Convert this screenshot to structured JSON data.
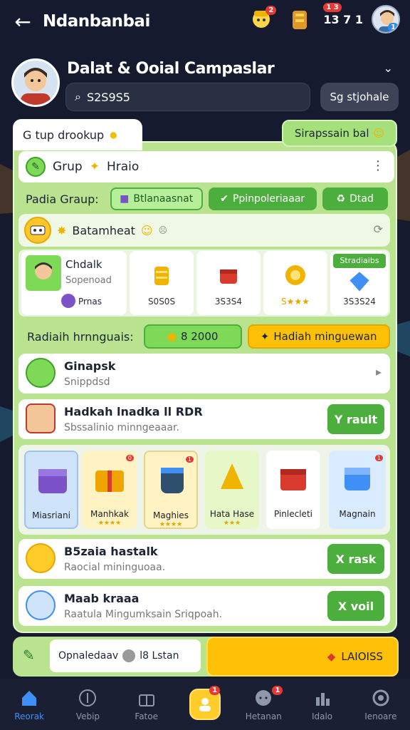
{
  "topbar": {
    "title": "Ndanbanbai",
    "back_label": "←",
    "coin_count": "13 7 1",
    "coin_badge": "1 3",
    "avatar_badge": "1",
    "mascot_badge": "2"
  },
  "header": {
    "title": "Dalat & Ooial Campaslar",
    "search_value": "S2S9S5",
    "search_button": "Sg stjohale"
  },
  "tabs": {
    "active_label": "G tup drookup",
    "right_label": "Sirapssain bal"
  },
  "group_row": {
    "label": "Grup",
    "label2": "Hraio"
  },
  "filters": {
    "label": "Padia Graup:",
    "pill1": "Btlanaasnat",
    "pill2": "Ppinpoleriaaar",
    "pill3": "Dtad"
  },
  "campaign_row": {
    "label": "Batamheat"
  },
  "products": [
    {
      "name": "Chdalk",
      "sub": "Sopenoad",
      "tag": "Prnas",
      "value": ""
    },
    {
      "name": "",
      "value": "S0S0S"
    },
    {
      "name": "",
      "value": "3S3S4"
    },
    {
      "name": "",
      "value": "S★★★"
    },
    {
      "name": "Stradiaibs",
      "value": "3S3S24"
    }
  ],
  "rewards": {
    "label": "Radiaih hrnnguais:",
    "amount": "8 2000",
    "button": "Hadiah minguewan"
  },
  "items": [
    {
      "title": "Ginapsk",
      "subtitle": "Snippdsd",
      "button": ""
    },
    {
      "title": "Hadkah lnadka ll RDR",
      "subtitle": "Sbssalinio minngeaaar.",
      "button": "Y rault"
    },
    {
      "title": "B5zaia hastalk",
      "subtitle": "Raocial mininguoaa.",
      "button": "X rask"
    },
    {
      "title": "Maab kraaa",
      "subtitle": "Raatula Mingumksain Sriqpoah.",
      "button": "X voil"
    }
  ],
  "gifts": [
    {
      "label": "Miasriani",
      "stars": "",
      "badge": ""
    },
    {
      "label": "Manhkak",
      "stars": "★★★★",
      "badge": "0"
    },
    {
      "label": "Maghies",
      "stars": "★★★★",
      "badge": "1"
    },
    {
      "label": "Hata Hase",
      "stars": "★★★",
      "badge": ""
    },
    {
      "label": "Pinlecleti",
      "stars": "",
      "badge": ""
    },
    {
      "label": "Magnain",
      "stars": "",
      "badge": "1"
    }
  ],
  "bottom": {
    "chat_label": "Opnaledaav",
    "chat_tag": "l8 Lstan",
    "cta_label": "LAIOISS"
  },
  "nav": [
    {
      "label": "Reorak",
      "icon": "home-icon"
    },
    {
      "label": "Vebip",
      "icon": "compass-icon"
    },
    {
      "label": "Fatoe",
      "icon": "gift-icon"
    },
    {
      "label": "",
      "icon": "user-icon",
      "badge": "1"
    },
    {
      "label": "Hetanan",
      "icon": "chat-icon",
      "badge": "1"
    },
    {
      "label": "Idalo",
      "icon": "chart-icon"
    },
    {
      "label": "Ienoare",
      "icon": "settings-icon"
    }
  ],
  "colors": {
    "panel": "#b9e38f",
    "button_green": "#4cae3c",
    "accent_yellow": "#ffc107",
    "bg": "#161a2e",
    "nav_active": "#3f8ff5"
  }
}
